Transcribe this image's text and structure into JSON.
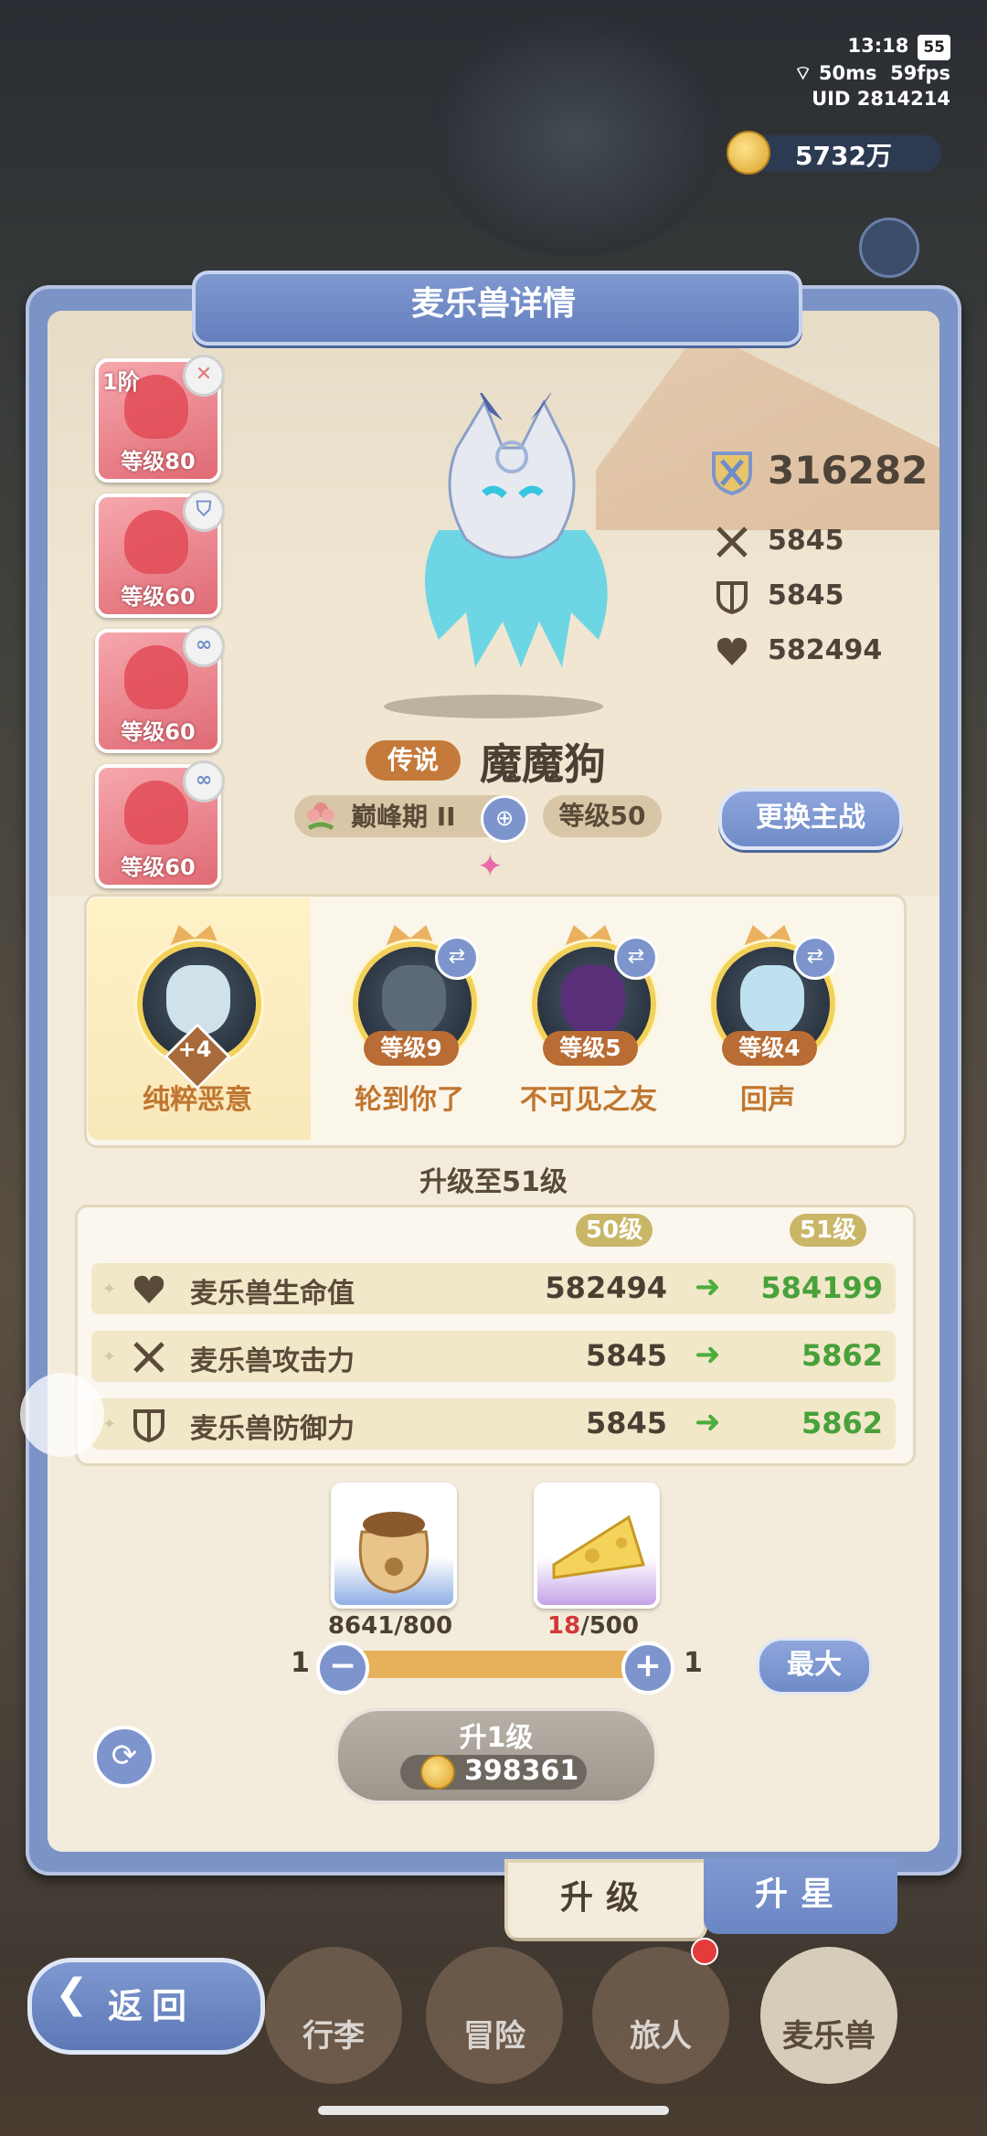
{
  "status_bar": {
    "time": "13:18",
    "battery": "55",
    "ping": "50ms",
    "fps": "59fps",
    "uid": "UID 2814214"
  },
  "currency": {
    "amount": "5732万"
  },
  "panel": {
    "title": "麦乐兽详情"
  },
  "team_slots": [
    {
      "tier": "1阶",
      "level": "等级80",
      "badge": "close-icon"
    },
    {
      "level": "等级60",
      "badge": "shield-icon"
    },
    {
      "level": "等级60",
      "badge": "link-icon"
    },
    {
      "level": "等级60",
      "badge": "link-icon"
    }
  ],
  "stats": {
    "power": "316282",
    "attack": "5845",
    "defense": "5845",
    "hp": "582494"
  },
  "pet": {
    "rarity": "传说",
    "name": "魔魔狗",
    "stage": "巅峰期 II",
    "level": "等级50",
    "swap_main": "更换主战"
  },
  "skills": {
    "main": {
      "name": "纯粹恶意",
      "bonus": "+4"
    },
    "list": [
      {
        "level": "等级9",
        "name": "轮到你了"
      },
      {
        "level": "等级5",
        "name": "不可见之友"
      },
      {
        "level": "等级4",
        "name": "回声"
      }
    ]
  },
  "upgrade": {
    "title": "升级至51级",
    "col_current": "50级",
    "col_next": "51级",
    "rows": [
      {
        "name": "麦乐兽生命值",
        "current": "582494",
        "next": "584199",
        "icon": "heart-icon"
      },
      {
        "name": "麦乐兽攻击力",
        "current": "5845",
        "next": "5862",
        "icon": "swords-icon"
      },
      {
        "name": "麦乐兽防御力",
        "current": "5845",
        "next": "5862",
        "icon": "shield-icon"
      }
    ]
  },
  "materials": [
    {
      "name": "food-bag-icon",
      "have": "8641",
      "need": "/800"
    },
    {
      "name": "cheese-icon",
      "have": "18",
      "need": "/500"
    }
  ],
  "quantity": {
    "min": "1",
    "max": "1",
    "max_button": "最大"
  },
  "upgrade_button": {
    "label": "升1级",
    "cost": "398361"
  },
  "tabs": {
    "upgrade": "升级",
    "star": "升星"
  },
  "nav": {
    "back": "返回",
    "items": [
      "行李",
      "冒险",
      "旅人",
      "麦乐兽"
    ]
  },
  "colors": {
    "panel_blue": "#7b93c7",
    "green_value": "#48a13a",
    "orange_skill": "#c0762f"
  }
}
